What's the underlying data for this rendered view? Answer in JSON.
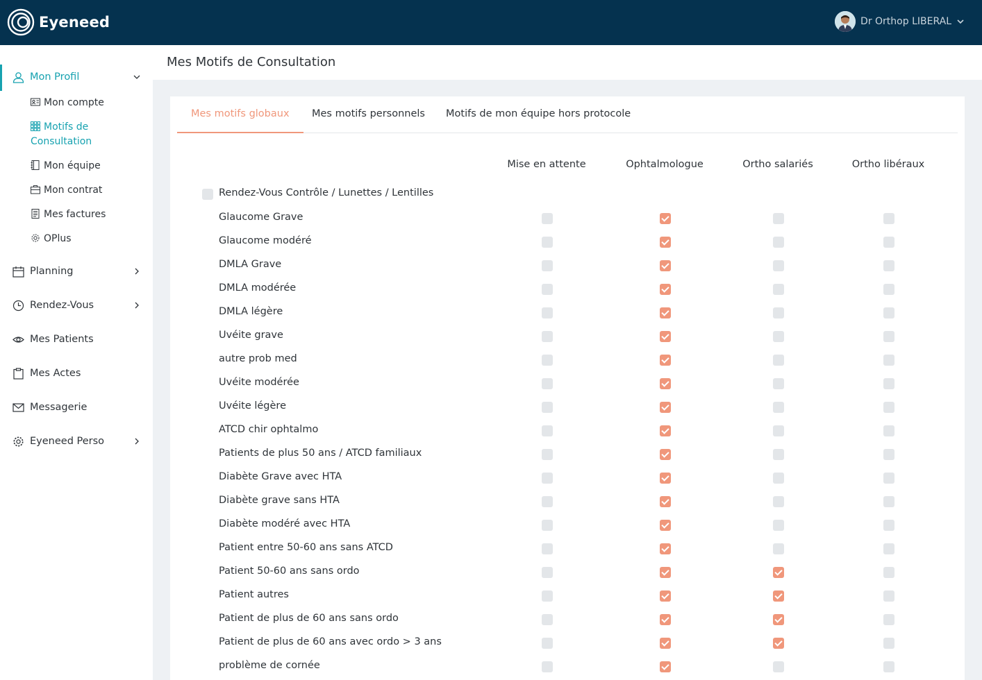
{
  "app": {
    "logo_text": "Eyeneed"
  },
  "user": {
    "name": "Dr Orthop LIBERAL"
  },
  "sidebar": {
    "profile": {
      "label": "Mon Profil"
    },
    "sub_items": [
      {
        "label": "Mon compte",
        "icon": "id-card-icon"
      },
      {
        "label": "Motifs de",
        "label2": "Consultation",
        "icon": "grid-icon"
      },
      {
        "label": "Mon équipe",
        "icon": "notebook-icon"
      },
      {
        "label": "Mon contrat",
        "icon": "briefcase-icon"
      },
      {
        "label": "Mes factures",
        "icon": "invoice-icon"
      },
      {
        "label": "OPlus",
        "icon": "gear-icon"
      }
    ],
    "items": [
      {
        "label": "Planning",
        "icon": "calendar-icon",
        "has_chevron": true
      },
      {
        "label": "Rendez-Vous",
        "icon": "clock-icon",
        "has_chevron": true
      },
      {
        "label": "Mes Patients",
        "icon": "eye-icon",
        "has_chevron": false
      },
      {
        "label": "Mes Actes",
        "icon": "clipboard-icon",
        "has_chevron": false
      },
      {
        "label": "Messagerie",
        "icon": "mail-icon",
        "has_chevron": false
      },
      {
        "label": "Eyeneed Perso",
        "icon": "gear-icon",
        "has_chevron": true
      }
    ]
  },
  "page": {
    "title": "Mes Motifs de Consultation"
  },
  "tabs": [
    {
      "label": "Mes motifs globaux",
      "active": true
    },
    {
      "label": "Mes motifs personnels",
      "active": false
    },
    {
      "label": "Motifs de mon équipe hors protocole",
      "active": false
    }
  ],
  "columns": [
    "Mise en attente",
    "Ophtalmologue",
    "Ortho salariés",
    "Ortho libéraux"
  ],
  "group": {
    "label": "Rendez-Vous Contrôle / Lunettes / Lentilles",
    "checked": false
  },
  "rows": [
    {
      "label": "Glaucome Grave",
      "values": [
        false,
        true,
        false,
        false
      ]
    },
    {
      "label": "Glaucome modéré",
      "values": [
        false,
        true,
        false,
        false
      ]
    },
    {
      "label": "DMLA Grave",
      "values": [
        false,
        true,
        false,
        false
      ]
    },
    {
      "label": "DMLA modérée",
      "values": [
        false,
        true,
        false,
        false
      ]
    },
    {
      "label": "DMLA légère",
      "values": [
        false,
        true,
        false,
        false
      ]
    },
    {
      "label": "Uvéite grave",
      "values": [
        false,
        true,
        false,
        false
      ]
    },
    {
      "label": "autre prob med",
      "values": [
        false,
        true,
        false,
        false
      ]
    },
    {
      "label": "Uvéite modérée",
      "values": [
        false,
        true,
        false,
        false
      ]
    },
    {
      "label": "Uvéite légère",
      "values": [
        false,
        true,
        false,
        false
      ]
    },
    {
      "label": "ATCD chir ophtalmo",
      "values": [
        false,
        true,
        false,
        false
      ]
    },
    {
      "label": "Patients de plus 50 ans / ATCD familiaux",
      "values": [
        false,
        true,
        false,
        false
      ]
    },
    {
      "label": "Diabète Grave avec HTA",
      "values": [
        false,
        true,
        false,
        false
      ]
    },
    {
      "label": "Diabète grave sans HTA",
      "values": [
        false,
        true,
        false,
        false
      ]
    },
    {
      "label": "Diabète modéré avec HTA",
      "values": [
        false,
        true,
        false,
        false
      ]
    },
    {
      "label": "Patient entre 50-60 ans sans ATCD",
      "values": [
        false,
        true,
        false,
        false
      ]
    },
    {
      "label": "Patient 50-60 ans sans ordo",
      "values": [
        false,
        true,
        true,
        false
      ]
    },
    {
      "label": "Patient autres",
      "values": [
        false,
        true,
        true,
        false
      ]
    },
    {
      "label": "Patient de plus de 60 ans sans ordo",
      "values": [
        false,
        true,
        true,
        false
      ]
    },
    {
      "label": "Patient de plus de 60 ans avec ordo > 3 ans",
      "values": [
        false,
        true,
        true,
        false
      ]
    },
    {
      "label": "problème de cornée",
      "values": [
        false,
        true,
        false,
        false
      ]
    }
  ],
  "colors": {
    "topbar": "#05324f",
    "accent": "#17a2b0",
    "checked": "#f0977b"
  }
}
